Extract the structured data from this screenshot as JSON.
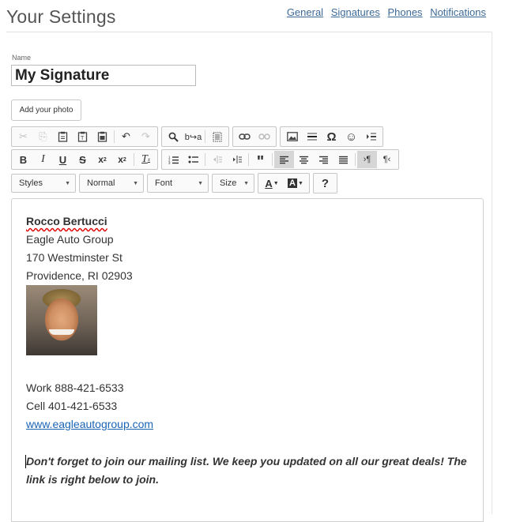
{
  "page": {
    "title": "Your Settings"
  },
  "nav": {
    "items": [
      "General",
      "Signatures",
      "Phones",
      "Notifications"
    ]
  },
  "form": {
    "name_label": "Name",
    "name_value": "My Signature",
    "photo_button": "Add your photo"
  },
  "toolbar": {
    "format_combos": [
      {
        "label": "Styles"
      },
      {
        "label": "Normal"
      },
      {
        "label": "Font"
      },
      {
        "label": "Size"
      }
    ],
    "text_color_label": "A",
    "bg_color_label": "A",
    "help_label": "?"
  },
  "signature": {
    "name": "Rocco Bertucci",
    "company": "Eagle Auto Group",
    "street": "170 Westminster St",
    "city_line": "Providence, RI 02903",
    "work": "Work 888-421-6533",
    "cell": "Cell 401-421-6533",
    "website": "www.eagleautogroup.com",
    "note": "Don't forget to join our mailing list. We keep you updated on all our great deals! The link is right below to join."
  },
  "colors": {
    "link": "#3d6a97",
    "accent": "#1a64b4"
  }
}
